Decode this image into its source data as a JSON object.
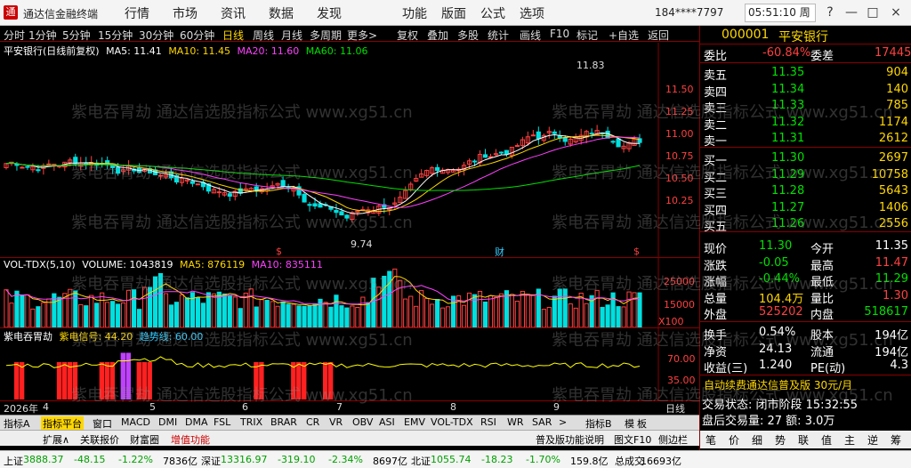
{
  "titlebar": {
    "logo": "通",
    "app_name": "通达信金融终端",
    "menus": [
      "行情",
      "市场",
      "资讯",
      "数据",
      "发现"
    ],
    "right_menus": [
      "功能",
      "版面",
      "公式",
      "选项"
    ],
    "user": "184****7797",
    "clock": "05:51:10 周一",
    "win_buttons": [
      "?",
      "—",
      "□",
      "×"
    ]
  },
  "toolbar": {
    "periods": [
      "分时",
      "1分钟",
      "5分钟",
      "15分钟",
      "30分钟",
      "60分钟",
      "日线",
      "周线",
      "月线",
      "多周期",
      "更多>"
    ],
    "active": "日线",
    "tools": [
      "复权",
      "叠加",
      "多股",
      "统计",
      "画线",
      "F10",
      "标记",
      "+自选",
      "返回"
    ]
  },
  "main_chart": {
    "title": "平安银行(日线前复权)",
    "ma5": "MA5: 11.41",
    "ma10": "MA10: 11.45",
    "ma20": "MA20: 11.60",
    "ma60": "MA60: 11.06",
    "high_label": "11.83",
    "low_label": "9.74",
    "yticks": [
      "11.50",
      "11.25",
      "11.00",
      "10.75",
      "10.50",
      "10.25"
    ],
    "markers": [
      "$",
      "财",
      "$"
    ]
  },
  "vol_chart": {
    "title": "VOL-TDX(5,10)",
    "volume": "VOLUME: 1043819",
    "ma5": "MA5: 876119",
    "ma10": "MA10: 835111",
    "yticks": [
      "25000",
      "15000",
      "X100"
    ]
  },
  "ind_chart": {
    "title": "紫电吞胃劫",
    "signal": "紫电信号: 44.20",
    "ma": "趋势线: 60.00",
    "yticks": [
      "70.00",
      "35.00"
    ]
  },
  "xaxis": {
    "labels": [
      "2026年",
      "4",
      "5",
      "6",
      "7",
      "8",
      "9"
    ],
    "right": "日线"
  },
  "tabs1": {
    "items": [
      "指标A",
      "指标平台",
      "窗口",
      "MACD",
      "DMI",
      "DMA",
      "FSL",
      "TRIX",
      "BRAR",
      "CR",
      "VR",
      "OBV",
      "ASI",
      "EMV",
      "VOL-TDX",
      "RSI",
      "WR",
      "SAR",
      ">",
      "指标B",
      "模",
      "板"
    ],
    "active": "指标平台"
  },
  "tabs2": {
    "items": [
      "扩展∧",
      "关联报价",
      "财富圈",
      "增值功能"
    ],
    "right": [
      "普及版功能说明",
      "图文F10",
      "侧边栏"
    ]
  },
  "quote": {
    "code": "000001",
    "name": "平安银行",
    "weibi_label": "委比",
    "weibi": "-60.84%",
    "weicha_label": "委差",
    "weicha": "17445",
    "asks": [
      {
        "label": "卖五",
        "price": "11.35",
        "vol": "904"
      },
      {
        "label": "卖四",
        "price": "11.34",
        "vol": "140"
      },
      {
        "label": "卖三",
        "price": "11.33",
        "vol": "785"
      },
      {
        "label": "卖二",
        "price": "11.32",
        "vol": "1174"
      },
      {
        "label": "卖一",
        "price": "11.31",
        "vol": "2612"
      }
    ],
    "bids": [
      {
        "label": "买一",
        "price": "11.30",
        "vol": "2697"
      },
      {
        "label": "买二",
        "price": "11.29",
        "vol": "10758"
      },
      {
        "label": "买三",
        "price": "11.28",
        "vol": "5643"
      },
      {
        "label": "买四",
        "price": "11.27",
        "vol": "1406"
      },
      {
        "label": "买五",
        "price": "11.26",
        "vol": "2556"
      }
    ],
    "stats": [
      {
        "l1": "现价",
        "v1": "11.30",
        "l2": "今开",
        "v2": "11.35"
      },
      {
        "l1": "涨跌",
        "v1": "-0.05",
        "l2": "最高",
        "v2": "11.47"
      },
      {
        "l1": "涨幅",
        "v1": "-0.44%",
        "l2": "最低",
        "v2": "11.29"
      },
      {
        "l1": "总量",
        "v1": "104.4万",
        "l2": "量比",
        "v2": "1.30"
      },
      {
        "l1": "外盘",
        "v1": "525202",
        "l2": "内盘",
        "v2": "518617"
      }
    ],
    "stats2": [
      {
        "l1": "换手",
        "v1": "0.54%",
        "l2": "股本",
        "v2": "194亿"
      },
      {
        "l1": "净资",
        "v1": "24.13",
        "l2": "流通",
        "v2": "194亿"
      },
      {
        "l1": "收益(三)",
        "v1": "1.240",
        "l2": "PE(动)",
        "v2": "4.3"
      }
    ],
    "ad": "自动续费通达信普及版 30元/月",
    "state": "交易状态: 闭市阶段 15:32:55",
    "after": "盘后交易量: 27  额: 3.0万",
    "bottom_btns": [
      "笔",
      "价",
      "细",
      "势",
      "联",
      "值",
      "主",
      "逆",
      "筹"
    ]
  },
  "statusbar": {
    "items": [
      {
        "t": "上证",
        "c": "#000"
      },
      {
        "t": "3888.37",
        "c": "#00a000"
      },
      {
        "t": "-48.15",
        "c": "#00a000"
      },
      {
        "t": "-1.22%",
        "c": "#00a000"
      },
      {
        "t": "7836亿",
        "c": "#000"
      },
      {
        "t": "深证",
        "c": "#000"
      },
      {
        "t": "13316.97",
        "c": "#00a000"
      },
      {
        "t": "-319.10",
        "c": "#00a000"
      },
      {
        "t": "-2.34%",
        "c": "#00a000"
      },
      {
        "t": "8697亿",
        "c": "#000"
      },
      {
        "t": "北证",
        "c": "#000"
      },
      {
        "t": "1055.74",
        "c": "#00a000"
      },
      {
        "t": "-18.23",
        "c": "#00a000"
      },
      {
        "t": "-1.70%",
        "c": "#00a000"
      },
      {
        "t": "159.8亿",
        "c": "#000"
      },
      {
        "t": "总成交",
        "c": "#000"
      },
      {
        "t": "16693亿",
        "c": "#000"
      }
    ]
  },
  "watermark": "紫电吞胃劫 通达信选股指标公式 www.xg51.cn",
  "colors": {
    "up": "#ff4040",
    "down": "#00e0e0",
    "ma5": "#ffffff",
    "ma10": "#ffd700",
    "ma20": "#ff40ff",
    "ma60": "#00e000",
    "bg": "#000000",
    "grid": "#800000"
  }
}
